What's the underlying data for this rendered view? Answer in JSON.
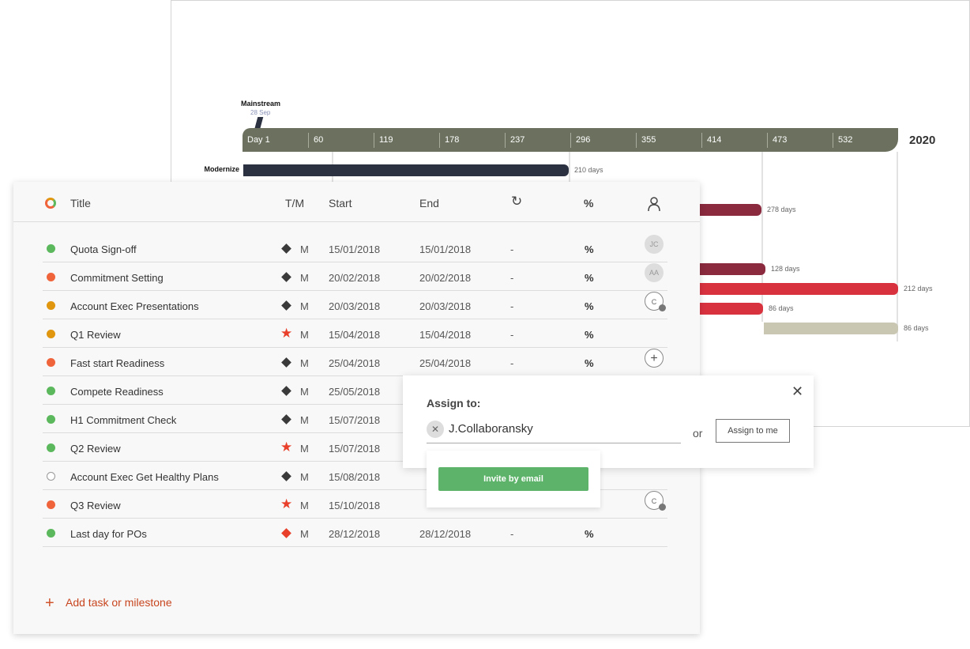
{
  "gantt": {
    "milestone": {
      "label": "Mainstream",
      "date": "28 Sep"
    },
    "ticks": [
      "Day 1",
      "60",
      "119",
      "178",
      "237",
      "296",
      "355",
      "414",
      "473",
      "532"
    ],
    "year": "2020",
    "bars": [
      {
        "label": "Modernize",
        "days": "210 days",
        "color": "#2b3140"
      },
      {
        "days": "278 days",
        "color": "#8b2a3e"
      },
      {
        "days": "128 days",
        "color": "#8b2a3e"
      },
      {
        "days": "212 days",
        "color": "#d9323f"
      },
      {
        "days": "86 days",
        "color": "#d9323f"
      },
      {
        "days": "86 days",
        "color": "#c9c6b2"
      }
    ]
  },
  "table": {
    "headers": {
      "title": "Title",
      "tm": "T/M",
      "start": "Start",
      "end": "End",
      "percent": "%"
    },
    "rows": [
      {
        "status": "#5cb85c",
        "title": "Quota Sign-off",
        "type": "diamond",
        "tm": "M",
        "start": "15/01/2018",
        "end": "15/01/2018",
        "dur": "-",
        "pct": "%",
        "assignee": "JC"
      },
      {
        "status": "#f0643c",
        "title": "Commitment Setting",
        "type": "diamond",
        "tm": "M",
        "start": "20/02/2018",
        "end": "20/02/2018",
        "dur": "-",
        "pct": "%",
        "assignee": "AA"
      },
      {
        "status": "#e0960f",
        "title": " Account Exec Presentations",
        "type": "diamond",
        "tm": "M",
        "start": "20/03/2018",
        "end": "20/03/2018",
        "dur": "-",
        "pct": "%",
        "assignee": "C",
        "pending": true
      },
      {
        "status": "#e0960f",
        "title": "Q1 Review",
        "type": "star",
        "tm": "M",
        "start": "15/04/2018",
        "end": "15/04/2018",
        "dur": "-",
        "pct": "%"
      },
      {
        "status": "#f0643c",
        "title": "Fast start Readiness",
        "type": "diamond",
        "tm": "M",
        "start": "25/04/2018",
        "end": "25/04/2018",
        "dur": "-",
        "pct": "%",
        "add": true
      },
      {
        "status": "#5cb85c",
        "title": "Compete Readiness",
        "type": "diamond",
        "tm": "M",
        "start": "25/05/2018"
      },
      {
        "status": "#5cb85c",
        "title": "H1 Commitment Check",
        "type": "diamond",
        "tm": "M",
        "start": "15/07/2018"
      },
      {
        "status": "#5cb85c",
        "title": "Q2 Review",
        "type": "star",
        "tm": "M",
        "start": "15/07/2018"
      },
      {
        "status": "none",
        "title": "Account Exec Get Healthy Plans",
        "type": "diamond",
        "tm": "M",
        "start": "15/08/2018"
      },
      {
        "status": "#f0643c",
        "title": "Q3 Review",
        "type": "star",
        "tm": "M",
        "start": "15/10/2018",
        "assignee": "C",
        "pending": true
      },
      {
        "status": "#5cb85c",
        "title": "Last day for POs",
        "type": "red-diamond",
        "tm": "M",
        "start": "28/12/2018",
        "end": "28/12/2018",
        "dur": "-",
        "pct": "%"
      }
    ],
    "add_label": "Add task or milestone"
  },
  "assign": {
    "title": "Assign to:",
    "value": "J.Collaboransky",
    "or": "or",
    "assign_me": "Assign to me",
    "invite": "Invite by email"
  }
}
